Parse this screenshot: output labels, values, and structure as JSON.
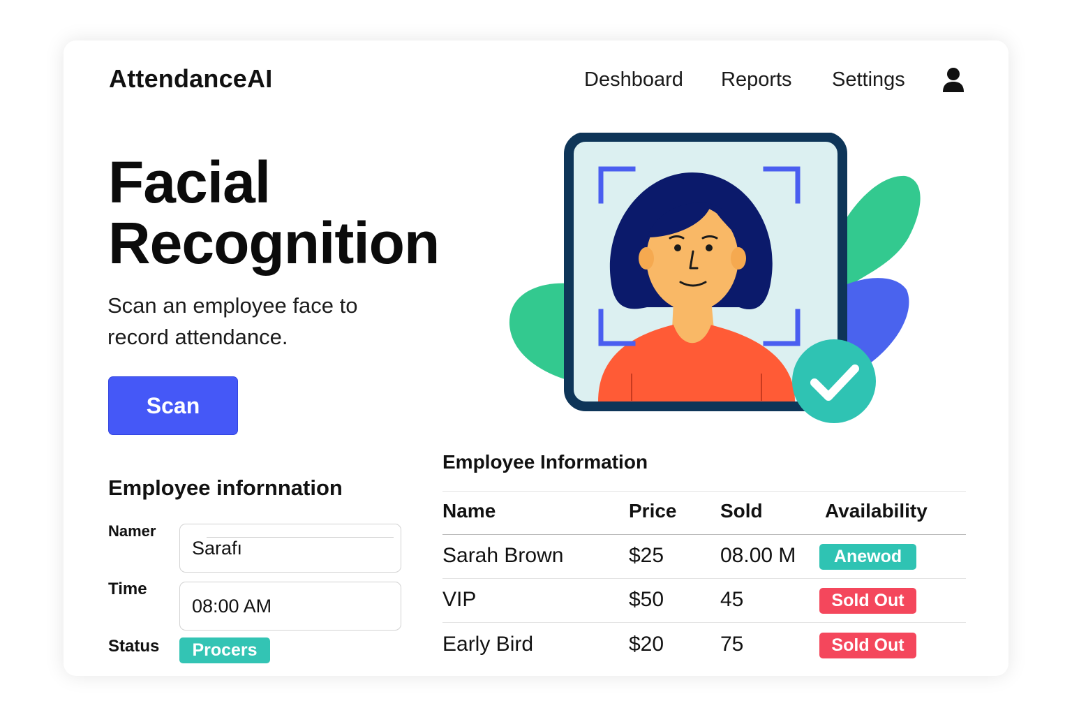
{
  "header": {
    "brand": "AttendanceAI",
    "nav": [
      "Deshboard",
      "Reports",
      "Settings"
    ]
  },
  "hero": {
    "title_line1": "Facial",
    "title_line2": "Recognition",
    "subtitle": "Scan an employee face to record attendance.",
    "scan_button": "Scan"
  },
  "form": {
    "title": "Employee infornnation",
    "name_label": "Namer",
    "name_value": "Sarafı",
    "time_label": "Time",
    "time_value": "08:00 AM",
    "status_label": "Status",
    "status_badge": "Procers"
  },
  "table": {
    "title": "Employee Information",
    "columns": [
      "Name",
      "Price",
      "Sold",
      "Availability"
    ],
    "rows": [
      {
        "name": "Sarah Brown",
        "price": "$25",
        "sold": "08.00 M",
        "availability": "Anewod"
      },
      {
        "name": "VIP",
        "price": "$50",
        "sold": "45",
        "availability": "Sold Out"
      },
      {
        "name": "Early Bird",
        "price": "$20",
        "sold": "75",
        "availability": "Sold Out"
      }
    ]
  },
  "icons": {
    "user": "user-icon",
    "check": "check-circle-icon",
    "scan_frame": "scan-frame-icon"
  },
  "colors": {
    "primary": "#4558f7",
    "teal": "#2fc3b3",
    "red": "#f4475c",
    "green_leaf": "#33c98f",
    "blue_leaf": "#4a63ee",
    "frame": "#0e3558"
  }
}
